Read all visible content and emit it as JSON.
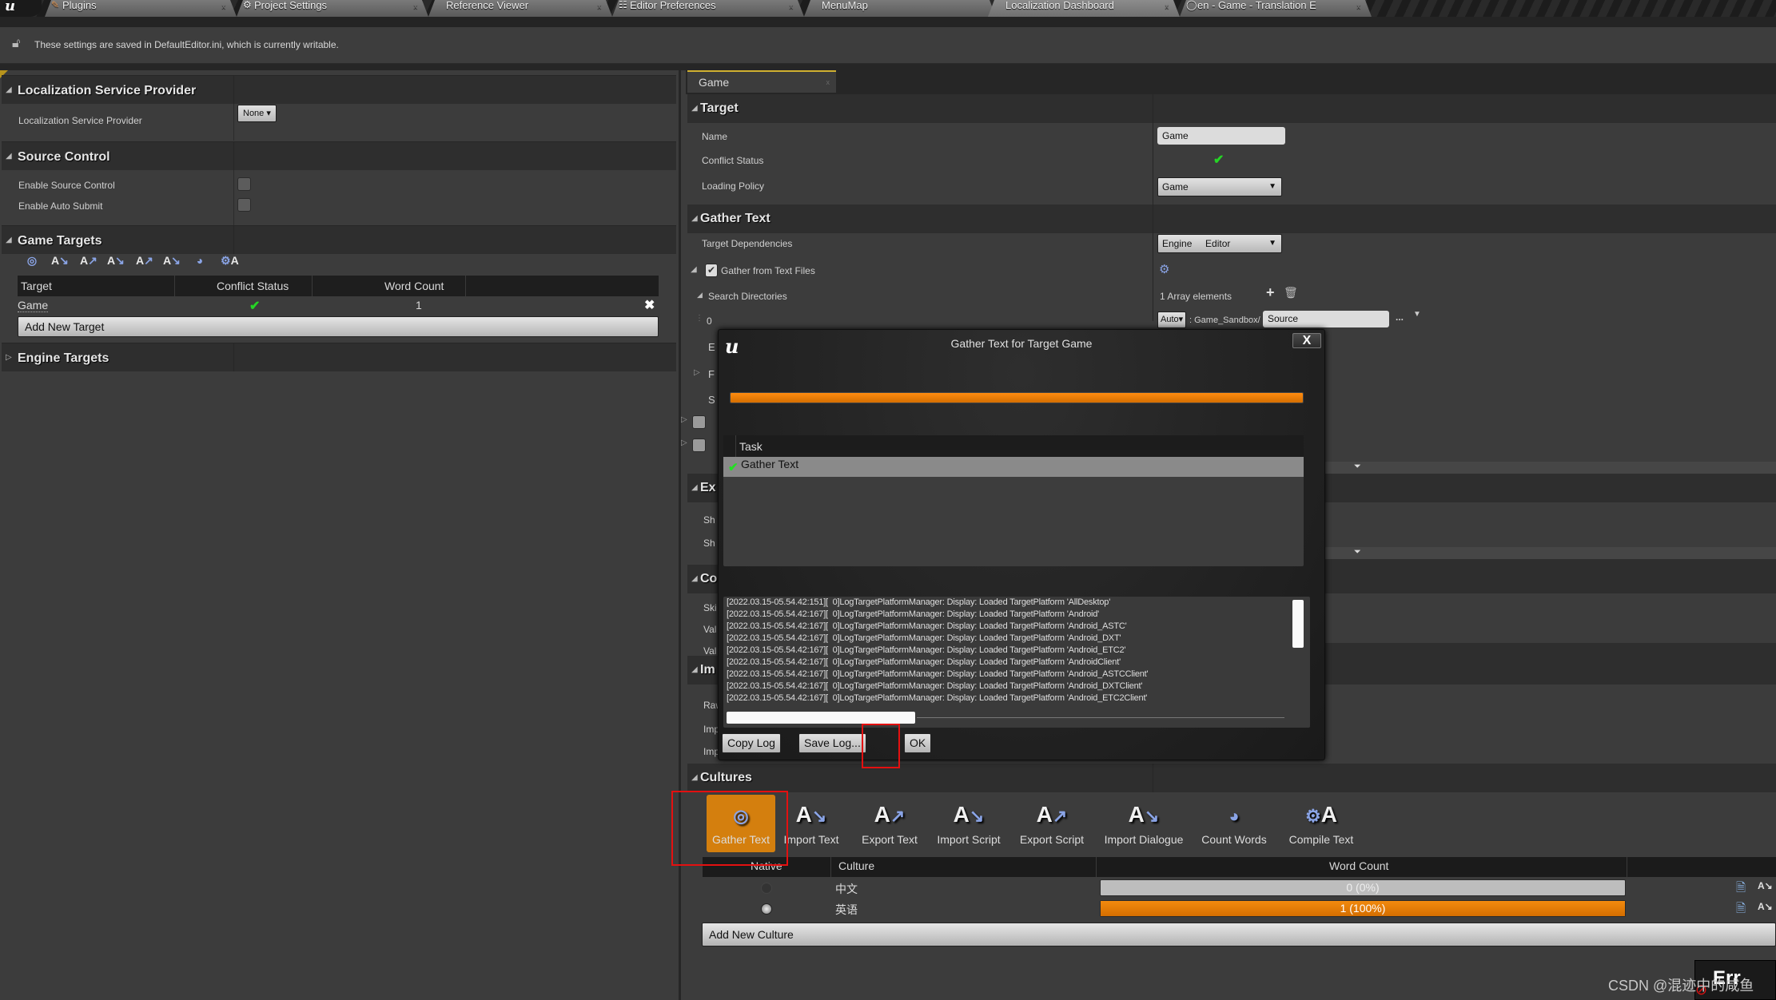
{
  "tabs": [
    {
      "label": "Plugins",
      "icon": "plug-icon"
    },
    {
      "label": "Project Settings",
      "icon": "gear-icon"
    },
    {
      "label": "Reference Viewer",
      "icon": ""
    },
    {
      "label": "Editor Preferences",
      "icon": "preferences-icon"
    },
    {
      "label": "MenuMap",
      "icon": ""
    },
    {
      "label": "Localization Dashboard",
      "icon": ""
    },
    {
      "label": "en - Game - Translation E",
      "icon": "loading-icon"
    }
  ],
  "banner": {
    "text": "These settings are saved in DefaultEditor.ini, which is currently writable."
  },
  "left": {
    "loc_service": {
      "title": "Localization Service Provider",
      "prop_label": "Localization Service Provider",
      "value": "None"
    },
    "source_control": {
      "title": "Source Control",
      "enable_label": "Enable Source Control",
      "auto_submit_label": "Enable Auto Submit",
      "enable_checked": false,
      "auto_submit_checked": false
    },
    "game_targets": {
      "title": "Game Targets",
      "toolbar_icons": [
        "gather-text-icon",
        "import-text-icon",
        "export-text-icon",
        "import-script-icon",
        "export-script-icon",
        "import-dialogue-icon",
        "count-words-icon",
        "compile-text-icon"
      ],
      "columns": [
        "Target",
        "Conflict Status",
        "Word Count"
      ],
      "rows": [
        {
          "target": "Game",
          "conflict": "ok",
          "word_count": "1"
        }
      ],
      "add_label": "Add New Target"
    },
    "engine_targets": {
      "title": "Engine Targets"
    }
  },
  "right": {
    "doc_tab": "Game",
    "target": {
      "title": "Target",
      "name_label": "Name",
      "name_value": "Game",
      "conflict_label": "Conflict Status",
      "loading_label": "Loading Policy",
      "loading_value": "Game"
    },
    "gather": {
      "title": "Gather Text",
      "deps_label": "Target Dependencies",
      "deps_values": [
        "Engine",
        "Editor"
      ],
      "from_files_label": "Gather from Text Files",
      "from_files_checked": true,
      "search_dirs_label": "Search Directories",
      "array_count": "1 Array elements",
      "index_label": "0",
      "path_mode": "Auto",
      "path_prefix": ": Game_Sandbox/",
      "path_value": "Source",
      "browse_label": "..."
    },
    "partial": {
      "e_label": "E",
      "f_label": "F",
      "s_label": "S",
      "ex_title": "Ex",
      "sh1": "Sh",
      "sh2": "Sh",
      "co_title": "Co",
      "ski": "Ski",
      "val1": "Val",
      "val2": "Val",
      "im_title": "Im",
      "raw": "Raw",
      "imp1": "Imp",
      "imp2": "Imp"
    },
    "cultures": {
      "title": "Cultures",
      "toolbar": [
        {
          "label": "Gather Text",
          "icon": "gather-text-icon",
          "active": true
        },
        {
          "label": "Import Text",
          "icon": "import-text-icon"
        },
        {
          "label": "Export Text",
          "icon": "export-text-icon"
        },
        {
          "label": "Import Script",
          "icon": "import-script-icon"
        },
        {
          "label": "Export Script",
          "icon": "export-script-icon"
        },
        {
          "label": "Import Dialogue",
          "icon": "import-dialogue-icon"
        },
        {
          "label": "Count Words",
          "icon": "count-words-icon"
        },
        {
          "label": "Compile Text",
          "icon": "compile-text-icon"
        }
      ],
      "columns": [
        "Native",
        "Culture",
        "Word Count"
      ],
      "rows": [
        {
          "native": false,
          "culture": "中文",
          "word_count": "0 (0%)",
          "percent": 0
        },
        {
          "native": true,
          "culture": "英语",
          "word_count": "1 (100%)",
          "percent": 100
        }
      ],
      "add_label": "Add New Culture"
    }
  },
  "dialog": {
    "title": "Gather Text for Target Game",
    "close_label": "X",
    "progress_percent": 100,
    "task_header": "Task",
    "tasks": [
      {
        "label": "Gather Text",
        "done": true
      }
    ],
    "log": [
      "[2022.03.15-05.54.42:151][  0]LogTargetPlatformManager: Display: Loaded TargetPlatform 'AllDesktop'",
      "[2022.03.15-05.54.42:167][  0]LogTargetPlatformManager: Display: Loaded TargetPlatform 'Android'",
      "[2022.03.15-05.54.42:167][  0]LogTargetPlatformManager: Display: Loaded TargetPlatform 'Android_ASTC'",
      "[2022.03.15-05.54.42:167][  0]LogTargetPlatformManager: Display: Loaded TargetPlatform 'Android_DXT'",
      "[2022.03.15-05.54.42:167][  0]LogTargetPlatformManager: Display: Loaded TargetPlatform 'Android_ETC2'",
      "[2022.03.15-05.54.42:167][  0]LogTargetPlatformManager: Display: Loaded TargetPlatform 'AndroidClient'",
      "[2022.03.15-05.54.42:167][  0]LogTargetPlatformManager: Display: Loaded TargetPlatform 'Android_ASTCClient'",
      "[2022.03.15-05.54.42:167][  0]LogTargetPlatformManager: Display: Loaded TargetPlatform 'Android_DXTClient'",
      "[2022.03.15-05.54.42:167][  0]LogTargetPlatformManager: Display: Loaded TargetPlatform 'Android_ETC2Client'"
    ],
    "copy_label": "Copy Log",
    "save_label": "Save Log...",
    "ok_label": "OK"
  },
  "watermark": "CSDN @混迹中的咸鱼",
  "error_toast": "Err",
  "colors": {
    "accent": "#d47f0e",
    "progress": "#f28a0e",
    "check": "#25d425",
    "highlight": "#e41010"
  }
}
